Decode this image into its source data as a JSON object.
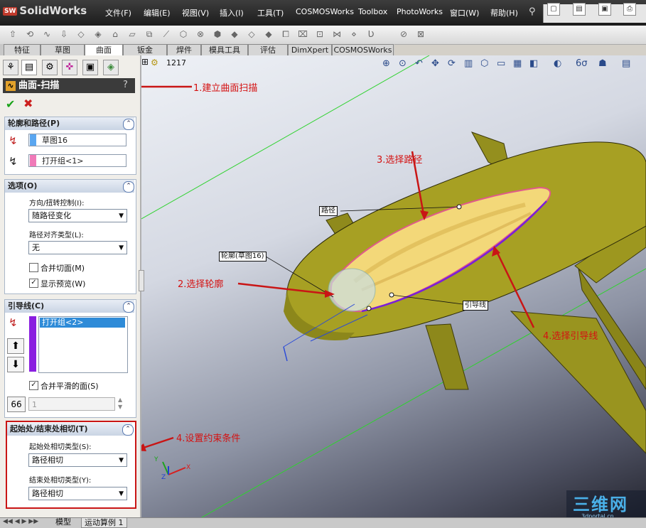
{
  "app": {
    "logo": "SolidWorks",
    "logo_badge": "SW"
  },
  "menu": [
    "文件(F)",
    "编辑(E)",
    "视图(V)",
    "插入(I)",
    "工具(T)",
    "COSMOSWorks",
    "Toolbox",
    "PhotoWorks",
    "窗口(W)",
    "帮助(H)"
  ],
  "tabs": [
    "特征",
    "草图",
    "曲面",
    "钣金",
    "焊件",
    "模具工具",
    "评估",
    "DimXpert",
    "COSMOSWorks"
  ],
  "active_tab": "曲面",
  "panel": {
    "feature_title": "曲面-扫描",
    "help": "?",
    "ok": "✔",
    "cancel": "✖",
    "profile_path": {
      "header": "轮廓和路径(P)",
      "profile_value": "草图16",
      "path_value": "打开组<1>"
    },
    "options": {
      "header": "选项(O)",
      "orientation_label": "方向/扭转控制(I):",
      "orientation_value": "随路径变化",
      "align_label": "路径对齐类型(L):",
      "align_value": "无",
      "merge_faces": "合并切面(M)",
      "merge_faces_checked": false,
      "show_preview": "显示预览(W)",
      "show_preview_checked": true
    },
    "guides": {
      "header": "引导线(C)",
      "list_item": "打开组<2>",
      "merge_smooth": "合并平滑的面(S)",
      "merge_smooth_checked": true,
      "count_value": "1"
    },
    "tangency": {
      "header": "起始处/结束处相切(T)",
      "start_label": "起始处相切类型(S):",
      "start_value": "路径相切",
      "end_label": "结束处相切类型(Y):",
      "end_value": "路径相切"
    }
  },
  "viewport": {
    "tree_item": "1217",
    "labels": {
      "path": "路径",
      "profile": "轮廓(草图16)",
      "guide": "引导线"
    },
    "axis": {
      "x": "X",
      "y": "Y",
      "z": "Z"
    }
  },
  "annotations": {
    "a1": "1.建立曲面扫描",
    "a2": "2.选择轮廓",
    "a3": "3.选择路径",
    "a4": "4.选择引导线",
    "a5": "4.设置约束条件"
  },
  "bottom_tabs": [
    "模型",
    "运动算例 1"
  ],
  "watermark": "三维网",
  "watermark_sub": "3dportal.cn",
  "colors": {
    "annotation": "#d41212",
    "model_surface": "#a7a023",
    "path_line": "#e05a8a",
    "guide_line": "#7a1fd9",
    "preview": "#f3d879"
  }
}
